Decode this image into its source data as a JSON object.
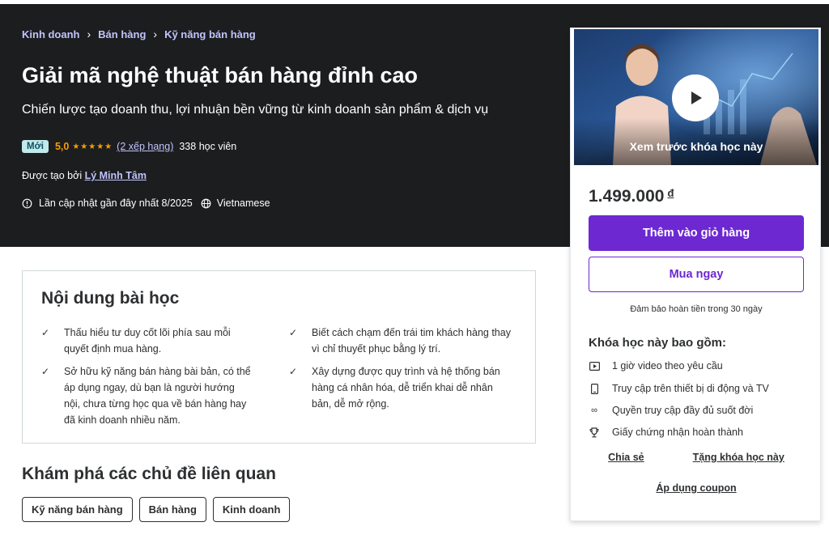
{
  "breadcrumb": [
    "Kinh doanh",
    "Bán hàng",
    "Kỹ năng bán hàng"
  ],
  "course": {
    "title": "Giải mã nghệ thuật bán hàng đỉnh cao",
    "subtitle": "Chiến lược tạo doanh thu, lợi nhuận bền vững từ kinh doanh sản phẩm & dịch vụ",
    "badge": "Mới",
    "rating": "5,0",
    "stars": "★★★★★",
    "rating_value": 5.0,
    "reviews": "(2 xếp hạng)",
    "students": "338 học viên",
    "created_by_label": "Được tạo bởi",
    "instructor": "Lý Minh Tâm",
    "last_updated": "Lần cập nhật gần đây nhất 8/2025",
    "language": "Vietnamese"
  },
  "learn": {
    "title": "Nội dung bài học",
    "items": [
      "Thấu hiểu tư duy cốt lõi phía sau mỗi quyết định mua hàng.",
      "Biết cách chạm đến trái tim khách hàng thay vì chỉ thuyết phục bằng lý trí.",
      "Sở hữu kỹ năng bán hàng bài bản, có thể áp dụng ngay, dù bạn là người hướng nội, chưa từng học qua về bán hàng hay đã kinh doanh nhiều năm.",
      "Xây dựng được quy trình và hệ thống bán hàng cá nhân hóa, dễ triển khai dễ nhân bản, dễ mở rộng."
    ]
  },
  "topics": {
    "title": "Khám phá các chủ đề liên quan",
    "items": [
      "Kỹ năng bán hàng",
      "Bán hàng",
      "Kinh doanh"
    ]
  },
  "sidebar": {
    "preview_label": "Xem trước khóa học này",
    "price": "1.499.000",
    "currency": "đ",
    "add_to_cart": "Thêm vào giỏ hàng",
    "buy_now": "Mua ngay",
    "guarantee": "Đảm bảo hoàn tiền trong 30 ngày",
    "includes_title": "Khóa học này bao gồm:",
    "includes": [
      {
        "icon": "video-icon",
        "text": "1 giờ video theo yêu cầu"
      },
      {
        "icon": "mobile-icon",
        "text": "Truy cập trên thiết bị di động và TV"
      },
      {
        "icon": "infinity-icon",
        "text": "Quyền truy cập đầy đủ suốt đời"
      },
      {
        "icon": "trophy-icon",
        "text": "Giấy chứng nhận hoàn thành"
      }
    ],
    "share": "Chia sẻ",
    "gift": "Tặng khóa học này",
    "coupon": "Áp dụng coupon"
  },
  "colors": {
    "hero_bg": "#1c1d1f",
    "accent": "#6d28d2",
    "link_light": "#c0c4fc",
    "star": "#f69c08",
    "badge_bg": "#c2e9eb"
  }
}
